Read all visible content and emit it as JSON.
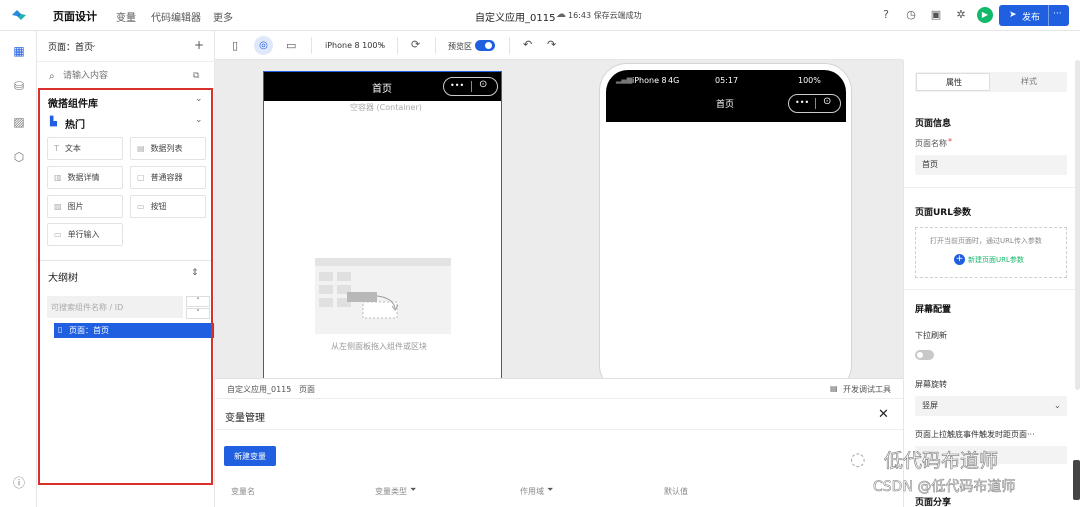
{
  "topbar": {
    "nav": [
      "页面设计",
      "变量",
      "代码编辑器",
      "更多"
    ],
    "app_title": "自定义应用_0115",
    "save_status": "16:43 保存云端成功",
    "publish_label": "发布",
    "more_label": "···"
  },
  "left": {
    "page_selector": "页面：首页",
    "add_label": "+",
    "search_placeholder": "请输入内容",
    "library_title": "微搭组件库",
    "hot_title": "热门",
    "components": [
      "文本",
      "数据列表",
      "数据详情",
      "普通容器",
      "图片",
      "按钮",
      "单行输入"
    ],
    "outline_title": "大纲树",
    "outline_search_placeholder": "可搜索组件名称 / ID",
    "outline_item": "页面：首页"
  },
  "toolbar": {
    "device": "iPhone 8 100%",
    "preview_label": "预览区",
    "preview_on": true
  },
  "canvas": {
    "page_header_title": "首页",
    "container_label": "空容器 (Container)",
    "drop_hint": "从左侧面板拖入组件或区块",
    "phone_carrier": "iPhone 8",
    "phone_network": "4G",
    "phone_time": "05:17",
    "phone_battery": "100%",
    "phone_title": "首页"
  },
  "bottom": {
    "breadcrumb": [
      "自定义应用_0115",
      "页面"
    ],
    "dev_tools": "开发调试工具",
    "panel_title": "变量管理",
    "new_var_button": "新建变量",
    "columns": [
      "变量名",
      "变量类型",
      "作用域",
      "默认值"
    ]
  },
  "right": {
    "tabs": [
      "属性",
      "样式"
    ],
    "active_tab": "属性",
    "page_info_title": "页面信息",
    "page_name_label": "页面名称",
    "page_name_value": "首页",
    "url_params_title": "页面URL参数",
    "url_params_hint": "打开当前页面时，通过URL传入参数",
    "new_url_param": "新建页面URL参数",
    "screen_config_title": "屏幕配置",
    "pull_refresh_label": "下拉刷新",
    "rotation_label": "屏幕旋转",
    "rotation_value": "竖屏",
    "pull_trigger_label": "页面上拉触底事件触发时距页面···",
    "share_title": "页面分享"
  },
  "watermark": {
    "line1": "低代码布道师",
    "line2": "CSDN @低代码布道师"
  },
  "colors": {
    "brand": "#1f5fe0",
    "highlight_frame": "#d9302c",
    "page_header_bg": "#000000",
    "green_run": "#13b96b"
  }
}
